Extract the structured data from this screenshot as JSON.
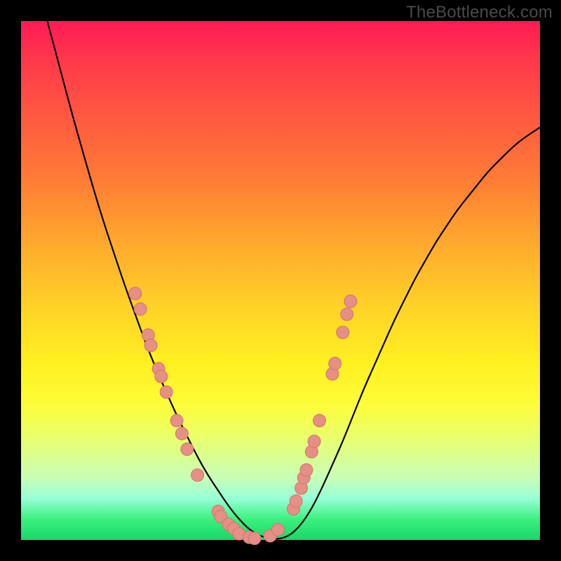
{
  "watermark": "TheBottleneck.com",
  "colors": {
    "curve": "#000000",
    "marker_fill": "#e58f86",
    "marker_stroke": "#d37468",
    "gradient_top": "#ff1a55",
    "gradient_bottom": "#17d867",
    "frame": "#000000"
  },
  "chart_data": {
    "type": "line",
    "title": "",
    "xlabel": "",
    "ylabel": "",
    "xlim": [
      0,
      100
    ],
    "ylim": [
      0,
      100
    ],
    "x": [
      0,
      2,
      4,
      6,
      8,
      10,
      12,
      14,
      16,
      18,
      20,
      22,
      24,
      26,
      28,
      30,
      32,
      34,
      36,
      38,
      40,
      42,
      44,
      46,
      48,
      50,
      52,
      54,
      56,
      58,
      60,
      62,
      64,
      66,
      68,
      70,
      72,
      74,
      76,
      78,
      80,
      82,
      84,
      86,
      88,
      90,
      92,
      94,
      96,
      98,
      100
    ],
    "values": [
      120,
      112,
      104,
      96.5,
      89,
      81.5,
      74.5,
      67.5,
      61,
      55,
      49,
      43.5,
      38,
      33,
      28.5,
      24,
      20,
      16,
      12.5,
      9.5,
      6.5,
      4,
      2,
      0.8,
      0.2,
      0.2,
      1,
      3,
      6,
      10,
      14.5,
      19,
      24,
      29,
      33.5,
      38,
      42.5,
      46.5,
      50.5,
      54,
      57.5,
      60.5,
      63.5,
      66,
      68.5,
      71,
      73,
      75,
      76.8,
      78.2,
      79.5
    ],
    "markers": [
      {
        "x": 22,
        "y": 47.5
      },
      {
        "x": 23,
        "y": 44.5
      },
      {
        "x": 24.5,
        "y": 39.5
      },
      {
        "x": 25,
        "y": 37.5
      },
      {
        "x": 26.5,
        "y": 33
      },
      {
        "x": 27,
        "y": 31.5
      },
      {
        "x": 28,
        "y": 28.5
      },
      {
        "x": 30,
        "y": 23
      },
      {
        "x": 31,
        "y": 20.5
      },
      {
        "x": 32,
        "y": 17.5
      },
      {
        "x": 34,
        "y": 12.5
      },
      {
        "x": 38,
        "y": 5.5
      },
      {
        "x": 38.5,
        "y": 4.5
      },
      {
        "x": 40,
        "y": 3
      },
      {
        "x": 41,
        "y": 2.2
      },
      {
        "x": 42,
        "y": 1.2
      },
      {
        "x": 44,
        "y": 0.5
      },
      {
        "x": 45,
        "y": 0.3
      },
      {
        "x": 48,
        "y": 0.8
      },
      {
        "x": 49.5,
        "y": 2
      },
      {
        "x": 52.5,
        "y": 6
      },
      {
        "x": 53,
        "y": 7.5
      },
      {
        "x": 54,
        "y": 10
      },
      {
        "x": 54.5,
        "y": 12
      },
      {
        "x": 55,
        "y": 13.5
      },
      {
        "x": 56,
        "y": 17
      },
      {
        "x": 56.5,
        "y": 19
      },
      {
        "x": 57.5,
        "y": 23
      },
      {
        "x": 60,
        "y": 32
      },
      {
        "x": 60.5,
        "y": 34
      },
      {
        "x": 62,
        "y": 40
      },
      {
        "x": 62.8,
        "y": 43.5
      },
      {
        "x": 63.5,
        "y": 46
      }
    ],
    "marker_radius_px": 9
  }
}
